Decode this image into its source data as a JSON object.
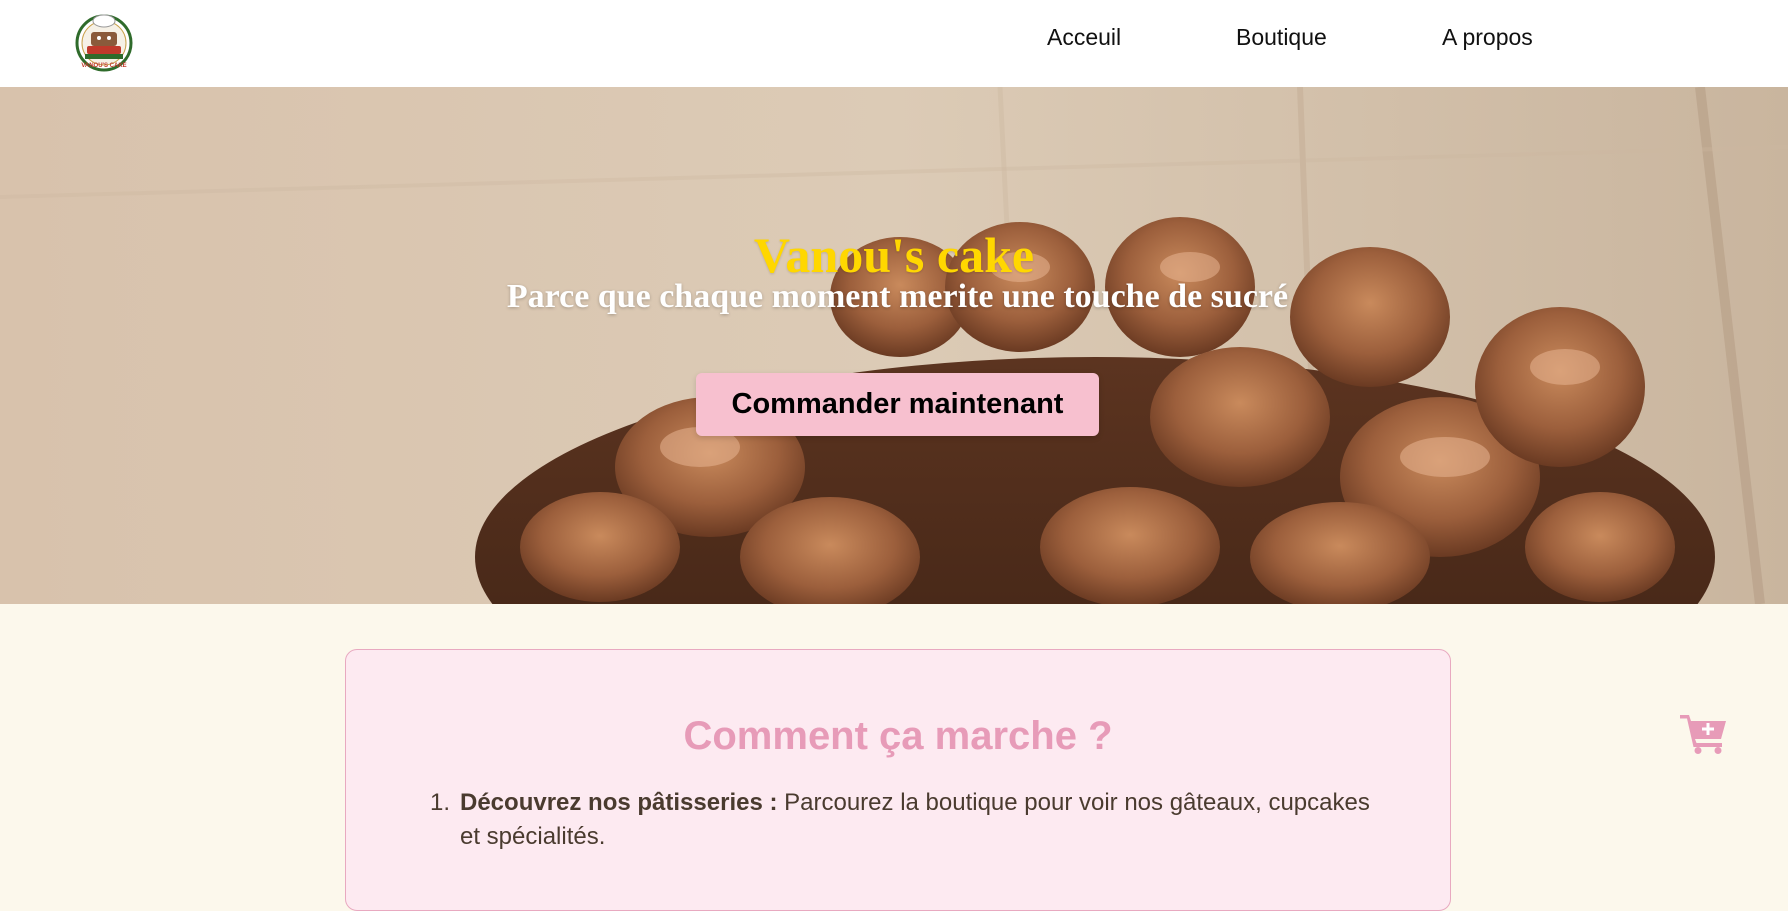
{
  "nav": {
    "logo_text": "VANOU'S CAKE",
    "links": [
      "Acceuil",
      "Boutique",
      "A propos"
    ]
  },
  "hero": {
    "title": "Vanou's cake",
    "subtitle": "Parce que chaque moment merite une touche de sucré",
    "cta_label": "Commander maintenant"
  },
  "how_it_works": {
    "title": "Comment ça marche ?",
    "steps": [
      {
        "number": "1.",
        "strong": "Découvrez nos pâtisseries :",
        "text": " Parcourez la boutique pour voir nos gâteaux, cupcakes et spécialités."
      }
    ]
  },
  "icons": {
    "cart": "cart-plus-icon"
  },
  "colors": {
    "accent_pink": "#e79bb8",
    "button_pink": "#f7c0cf",
    "title_gold": "#ffd700",
    "page_bg": "#fcf8ec",
    "card_bg": "#fdeaf1"
  }
}
